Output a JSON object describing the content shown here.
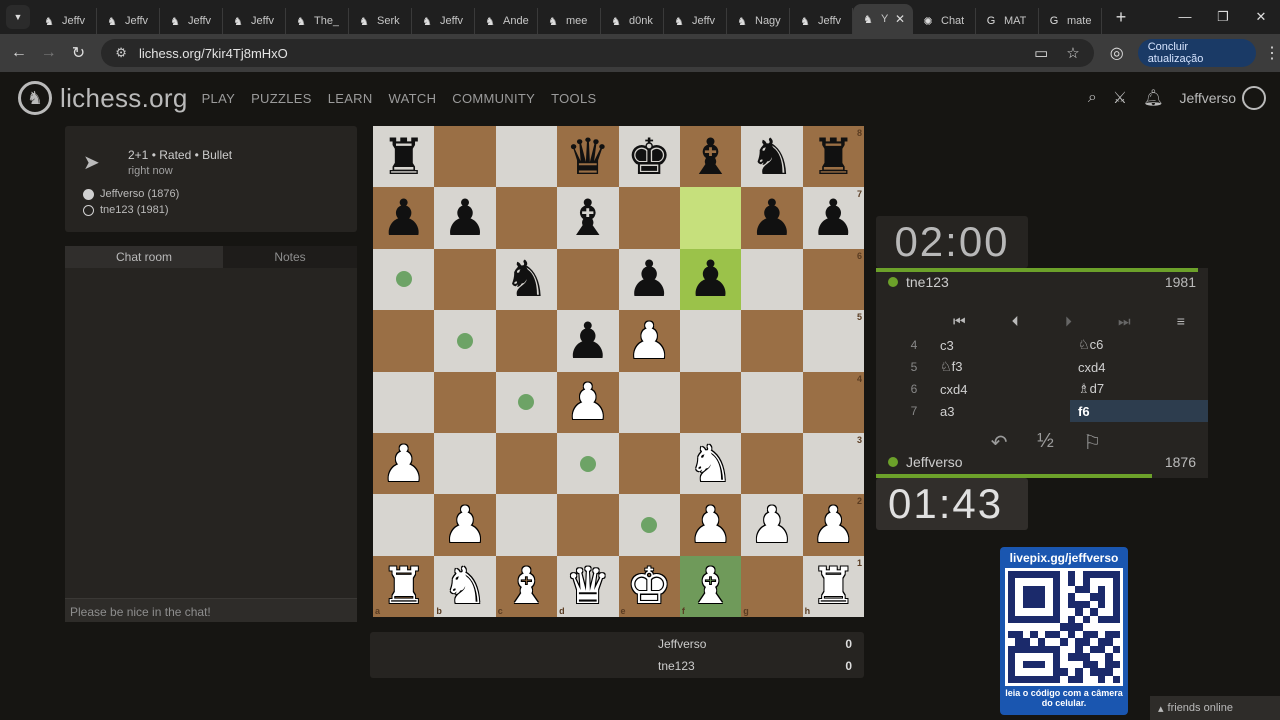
{
  "browser": {
    "tabs": [
      {
        "label": "Jeffv",
        "icon": "lichess-icon"
      },
      {
        "label": "Jeffv",
        "icon": "lichess-icon"
      },
      {
        "label": "Jeffv",
        "icon": "lichess-icon"
      },
      {
        "label": "Jeffv",
        "icon": "lichess-icon"
      },
      {
        "label": "The_",
        "icon": "lichess-icon"
      },
      {
        "label": "Serk",
        "icon": "lichess-icon"
      },
      {
        "label": "Jeffv",
        "icon": "lichess-icon"
      },
      {
        "label": "Ande",
        "icon": "lichess-icon"
      },
      {
        "label": "mee",
        "icon": "lichess-icon"
      },
      {
        "label": "d0nk",
        "icon": "lichess-icon"
      },
      {
        "label": "Jeffv",
        "icon": "lichess-icon"
      },
      {
        "label": "Nagy",
        "icon": "lichess-icon"
      },
      {
        "label": "Jeffv",
        "icon": "lichess-icon"
      },
      {
        "label": "Y",
        "icon": "lichess-icon"
      },
      {
        "label": "Chat",
        "icon": "chatgpt-icon"
      },
      {
        "label": "MAT",
        "icon": "google-icon"
      },
      {
        "label": "mate",
        "icon": "google-icon"
      }
    ],
    "url": "lichess.org/7kir4Tj8mHxO",
    "update_button": "Concluir atualização"
  },
  "site": {
    "logo": "lichess.org",
    "nav": [
      "PLAY",
      "PUZZLES",
      "LEARN",
      "WATCH",
      "COMMUNITY",
      "TOOLS"
    ],
    "user": "Jeffverso"
  },
  "game": {
    "meta": "2+1 • Rated • Bullet",
    "ago": "right now",
    "white": "Jeffverso (1876)",
    "black": "tne123 (1981)"
  },
  "chat": {
    "tab_chat": "Chat room",
    "tab_notes": "Notes",
    "placeholder": "Please be nice in the chat!"
  },
  "board": {
    "ranks": [
      "8",
      "7",
      "6",
      "5",
      "4",
      "3",
      "2",
      "1"
    ],
    "files": [
      "a",
      "b",
      "c",
      "d",
      "e",
      "f",
      "g",
      "h"
    ],
    "position": [
      [
        "r",
        "",
        "",
        "q",
        "k",
        "b",
        "n",
        "r"
      ],
      [
        "p",
        "p",
        "",
        "b",
        "",
        "",
        "p",
        "p"
      ],
      [
        "",
        "",
        "n",
        "",
        "p",
        "p",
        "",
        ""
      ],
      [
        "",
        "",
        "",
        "p",
        "P",
        "",
        "",
        ""
      ],
      [
        "",
        "",
        "",
        "P",
        "",
        "",
        "",
        ""
      ],
      [
        "P",
        "",
        "",
        "",
        "",
        "N",
        "",
        ""
      ],
      [
        "",
        "P",
        "",
        "",
        "",
        "P",
        "P",
        "P"
      ],
      [
        "R",
        "N",
        "B",
        "Q",
        "K",
        "B",
        "",
        "R"
      ]
    ],
    "highlights": {
      "last_from": "f7",
      "last_to": "f6",
      "selected": "f1"
    },
    "move_dots": [
      "a6",
      "b5",
      "c4",
      "e2",
      "d3"
    ]
  },
  "score": {
    "rows": [
      {
        "name": "Jeffverso",
        "value": "0"
      },
      {
        "name": "tne123",
        "value": "0"
      }
    ]
  },
  "opponent": {
    "name": "tne123",
    "rating": "1981",
    "clock": "02:00"
  },
  "player": {
    "name": "Jeffverso",
    "rating": "1876",
    "clock": "01:43"
  },
  "moves": [
    {
      "n": "4",
      "w": "c3",
      "b": "♘c6"
    },
    {
      "n": "5",
      "w": "♘f3",
      "b": "cxd4"
    },
    {
      "n": "6",
      "w": "cxd4",
      "b": "♗d7"
    },
    {
      "n": "7",
      "w": "a3",
      "b": "f6"
    }
  ],
  "overlay": {
    "title": "livepix.gg/jeffverso",
    "caption": "leia o código com a câmera do celular."
  },
  "friends": "friends online"
}
